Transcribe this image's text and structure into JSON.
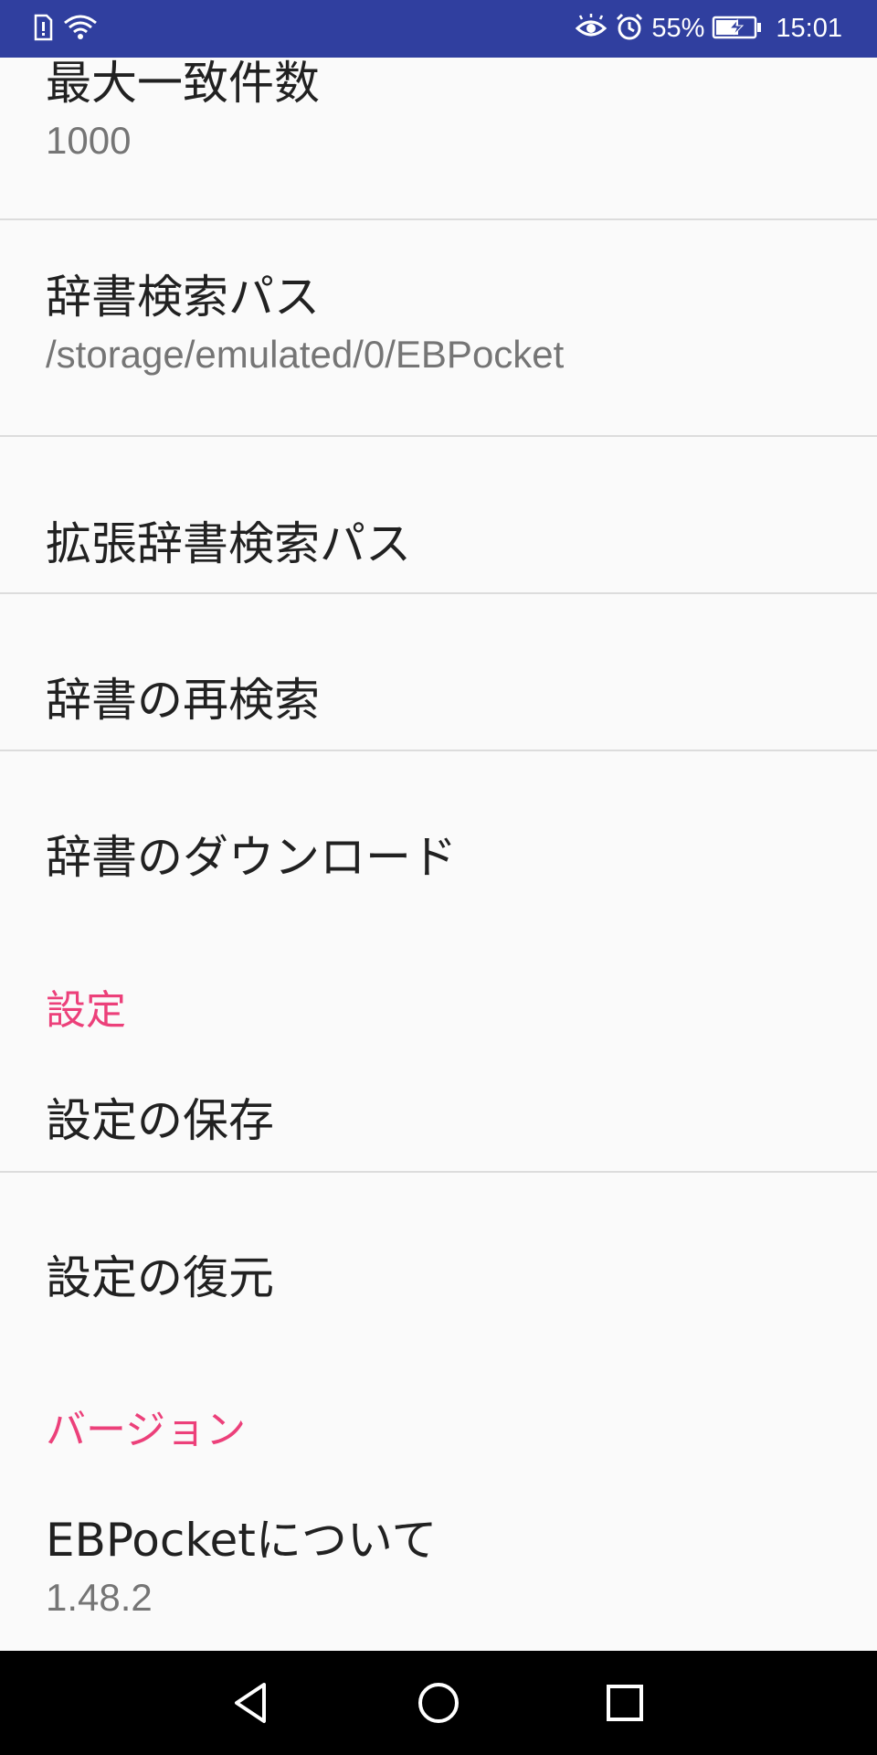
{
  "status_bar": {
    "battery_percent": "55%",
    "time": "15:01",
    "background_color": "#303f9f",
    "left_icons": [
      "sim-alert-icon",
      "wifi-icon"
    ],
    "right_icons": [
      "eye-comfort-icon",
      "alarm-icon",
      "battery-charging-icon"
    ]
  },
  "preferences": {
    "max_matches": {
      "title": "最大一致件数",
      "summary": "1000"
    },
    "dictionary_search_path": {
      "title": "辞書検索パス",
      "summary": "/storage/emulated/0/EBPocket"
    },
    "extended_search_path": {
      "title": "拡張辞書検索パス"
    },
    "rescan_dictionaries": {
      "title": "辞書の再検索"
    },
    "download_dictionaries": {
      "title": "辞書のダウンロード"
    }
  },
  "settings_section": {
    "header": "設定",
    "save": {
      "title": "設定の保存"
    },
    "restore": {
      "title": "設定の復元"
    }
  },
  "version_section": {
    "header": "バージョン",
    "about": {
      "title": "EBPocketについて",
      "summary": "1.48.2"
    }
  },
  "accent_color": "#ec407a",
  "nav_bar": {
    "icons": [
      "back-icon",
      "home-icon",
      "recents-icon"
    ]
  }
}
